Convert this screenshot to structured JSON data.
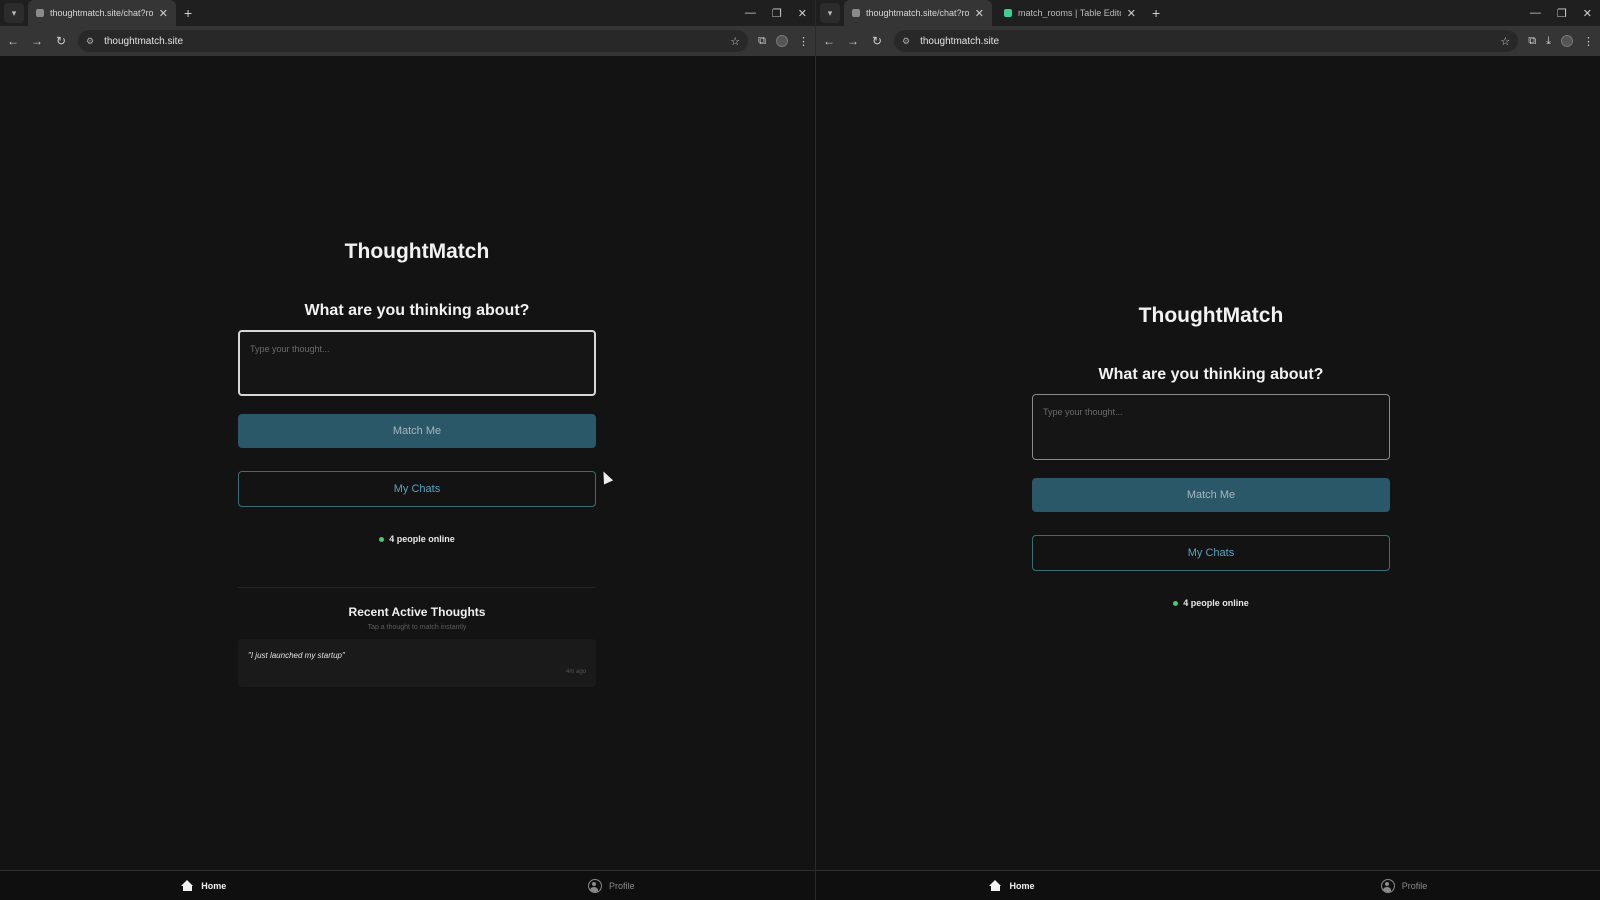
{
  "left": {
    "tabs": [
      {
        "title": "thoughtmatch.site/chat?room=",
        "active": true
      }
    ],
    "url": "thoughtmatch.site",
    "app": {
      "brand": "ThoughtMatch",
      "question": "What are you thinking about?",
      "thought_placeholder": "Type your thought...",
      "match_button": "Match Me",
      "chats_button": "My Chats",
      "online_text": "4 people online",
      "recent_title": "Recent Active Thoughts",
      "recent_subtitle": "Tap a thought to match instantly",
      "recent_items": [
        {
          "text": "\"I just launched my startup\"",
          "time": "4m ago"
        }
      ]
    },
    "nav": {
      "home": "Home",
      "profile": "Profile"
    }
  },
  "right": {
    "tabs": [
      {
        "title": "thoughtmatch.site/chat?room=",
        "active": true
      },
      {
        "title": "match_rooms | Table Editor | Th",
        "active": false
      }
    ],
    "url": "thoughtmatch.site",
    "app": {
      "brand": "ThoughtMatch",
      "question": "What are you thinking about?",
      "thought_placeholder": "Type your thought...",
      "match_button": "Match Me",
      "chats_button": "My Chats",
      "online_text": "4 people online"
    },
    "nav": {
      "home": "Home",
      "profile": "Profile"
    }
  },
  "colors": {
    "background": "#131313",
    "match_button": "#2a5868",
    "chats_accent": "#5ba3c2",
    "online_dot": "#3ecf70"
  }
}
